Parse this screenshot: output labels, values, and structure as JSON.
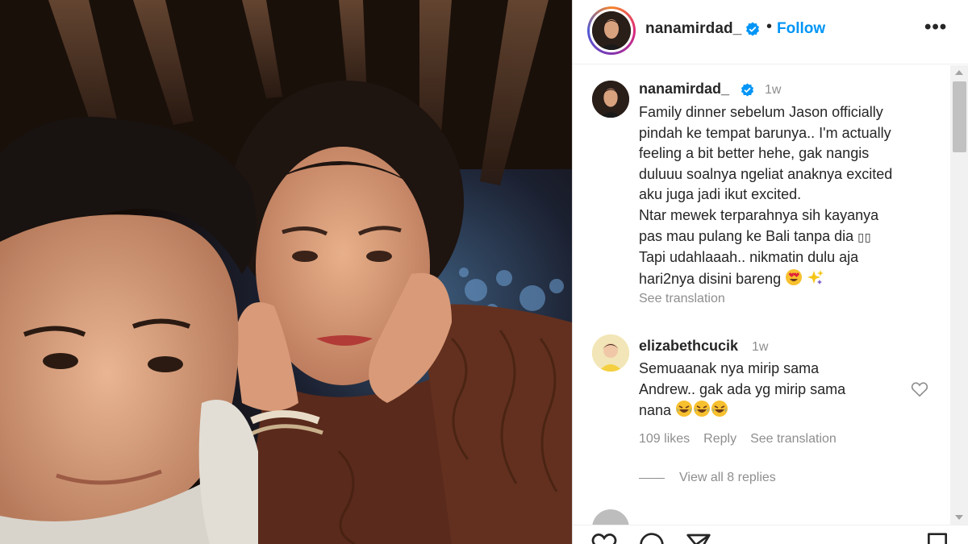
{
  "header": {
    "username": "nanamirdad_",
    "separator": "•",
    "follow_label": "Follow",
    "more_label": "•••"
  },
  "caption": {
    "username": "nanamirdad_",
    "time": "1w",
    "lines": [
      "Family dinner sebelum Jason officially",
      "pindah ke tempat barunya.. I'm actually",
      "feeling a bit better hehe, gak nangis",
      "duluuu soalnya ngeliat anaknya excited",
      "aku juga jadi ikut excited.",
      "Ntar mewek terparahnya sih kayanya",
      "pas mau pulang ke Bali tanpa dia",
      "Tapi udahlaaah.. nikmatin dulu aja",
      "hari2nya disini bareng"
    ],
    "see_translation": "See translation"
  },
  "comment": {
    "username": "elizabethcucik",
    "time": "1w",
    "lines": [
      "Semuaanak nya mirip sama",
      "Andrew.. gak ada yg mirip sama",
      "nana"
    ],
    "likes": "109 likes",
    "reply_label": "Reply",
    "see_translation": "See translation",
    "view_replies": "View all 8 replies"
  },
  "icons": {
    "verified": "verified-badge-icon",
    "like": "heart-icon",
    "comment": "comment-icon",
    "share": "send-icon",
    "save": "bookmark-icon",
    "emoji_caption": [
      "heart-eyes-emoji",
      "sparkles-emoji"
    ],
    "emoji_comment": [
      "rolling-laughing-emoji",
      "rolling-laughing-emoji",
      "rolling-laughing-emoji"
    ]
  },
  "colors": {
    "accent": "#0095f6",
    "verified": "#0095f6",
    "secondary_text": "#8e8e8e",
    "primary_text": "#262626"
  }
}
